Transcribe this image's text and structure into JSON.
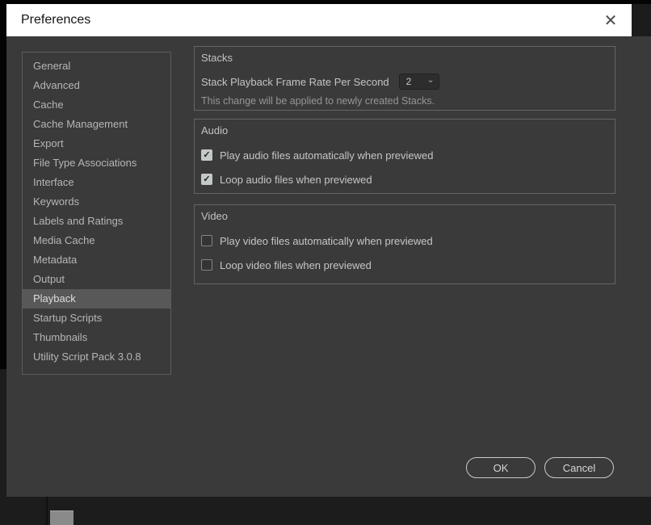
{
  "window": {
    "title": "Preferences",
    "close_icon": "✕"
  },
  "sidebar": {
    "items": [
      {
        "label": "General",
        "selected": false
      },
      {
        "label": "Advanced",
        "selected": false
      },
      {
        "label": "Cache",
        "selected": false
      },
      {
        "label": "Cache Management",
        "selected": false
      },
      {
        "label": "Export",
        "selected": false
      },
      {
        "label": "File Type Associations",
        "selected": false
      },
      {
        "label": "Interface",
        "selected": false
      },
      {
        "label": "Keywords",
        "selected": false
      },
      {
        "label": "Labels and Ratings",
        "selected": false
      },
      {
        "label": "Media Cache",
        "selected": false
      },
      {
        "label": "Metadata",
        "selected": false
      },
      {
        "label": "Output",
        "selected": false
      },
      {
        "label": "Playback",
        "selected": true
      },
      {
        "label": "Startup Scripts",
        "selected": false
      },
      {
        "label": "Thumbnails",
        "selected": false
      },
      {
        "label": "Utility Script Pack 3.0.8",
        "selected": false
      }
    ]
  },
  "sections": {
    "stacks": {
      "title": "Stacks",
      "frame_rate_label": "Stack Playback Frame Rate Per Second",
      "frame_rate_value": "2",
      "chevron": "⌄",
      "note": "This change will be applied to newly created Stacks."
    },
    "audio": {
      "title": "Audio",
      "options": [
        {
          "label": "Play audio files automatically when previewed",
          "checked": true
        },
        {
          "label": "Loop audio files when previewed",
          "checked": true
        }
      ]
    },
    "video": {
      "title": "Video",
      "options": [
        {
          "label": "Play video files automatically when previewed",
          "checked": false
        },
        {
          "label": "Loop video files when previewed",
          "checked": false
        }
      ]
    }
  },
  "footer": {
    "ok_label": "OK",
    "cancel_label": "Cancel"
  },
  "colors": {
    "dialog_bg": "#3a3a3a",
    "titlebar_bg": "#ffffff",
    "selected_item_bg": "#585858",
    "checkbox_checked_bg": "#c2c9c9"
  }
}
